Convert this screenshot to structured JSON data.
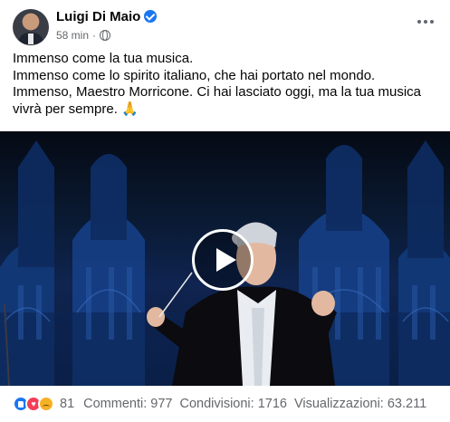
{
  "post": {
    "author": "Luigi Di Maio",
    "timestamp": "58 min",
    "lines": [
      "Immenso come la tua musica.",
      "Immenso come lo spirito italiano, che hai portato nel mondo.",
      "Immenso, Maestro Morricone. Ci hai lasciato oggi, ma la tua musica",
      "vivrà per sempre. 🙏"
    ]
  },
  "video": {
    "play_icon": "play-icon"
  },
  "engagement": {
    "reaction_icons": [
      "like-icon",
      "love-icon",
      "sad-icon"
    ],
    "reaction_count": "81",
    "comments": "Commenti: 977",
    "shares": "Condivisioni: 1716",
    "views": "Visualizzazioni: 63.211"
  },
  "colors": {
    "brand_blue": "#1877f2",
    "secondary_text": "#65676b",
    "love_red": "#f33e58",
    "sad_yellow": "#f7b125"
  }
}
